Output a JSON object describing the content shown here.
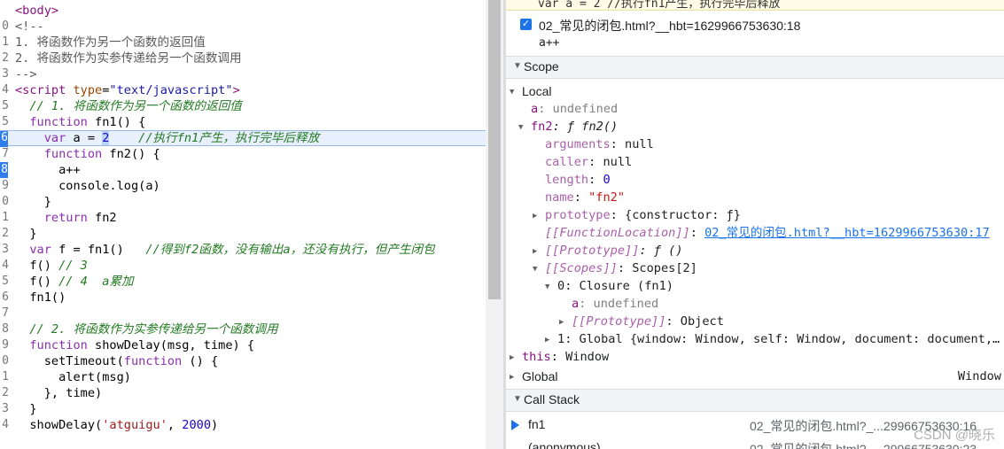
{
  "editor": {
    "lines": [
      {
        "gutter": "",
        "parts": [
          {
            "t": "<body>",
            "c": "tag"
          }
        ]
      },
      {
        "gutter": "0",
        "parts": [
          {
            "t": "<!--",
            "c": "cmb"
          }
        ]
      },
      {
        "gutter": "1",
        "parts": [
          {
            "t": "1. 将函数作为另一个函数的返回值",
            "c": "cmb"
          }
        ]
      },
      {
        "gutter": "2",
        "parts": [
          {
            "t": "2. 将函数作为实参传递给另一个函数调用",
            "c": "cmb"
          }
        ]
      },
      {
        "gutter": "3",
        "parts": [
          {
            "t": "-->",
            "c": "cmb"
          }
        ]
      },
      {
        "gutter": "4",
        "parts": [
          {
            "t": "<script ",
            "c": "tag"
          },
          {
            "t": "type",
            "c": "attr"
          },
          {
            "t": "=",
            "c": ""
          },
          {
            "t": "\"text/javascript\"",
            "c": "attrv"
          },
          {
            "t": ">",
            "c": "tag"
          }
        ]
      },
      {
        "gutter": "5",
        "parts": [
          {
            "t": "  // 1. 将函数作为另一个函数的返回值",
            "c": "cm"
          }
        ]
      },
      {
        "gutter": "5",
        "parts": [
          {
            "t": "  ",
            "c": ""
          },
          {
            "t": "function",
            "c": "kw"
          },
          {
            "t": " fn1() {",
            "c": ""
          }
        ]
      },
      {
        "gutter": "6",
        "bp": true,
        "hl": true,
        "parts": [
          {
            "t": "    ",
            "c": ""
          },
          {
            "t": "var",
            "c": "kw"
          },
          {
            "t": " a = ",
            "c": ""
          },
          {
            "t": "2",
            "c": "num sel"
          },
          {
            "t": "    ",
            "c": ""
          },
          {
            "t": "//执行fn1产生，执行完毕后释放",
            "c": "cm"
          }
        ]
      },
      {
        "gutter": "7",
        "parts": [
          {
            "t": "    ",
            "c": ""
          },
          {
            "t": "function",
            "c": "kw"
          },
          {
            "t": " fn2() {",
            "c": ""
          }
        ]
      },
      {
        "gutter": "8",
        "bp": true,
        "parts": [
          {
            "t": "      a++",
            "c": ""
          }
        ]
      },
      {
        "gutter": "9",
        "parts": [
          {
            "t": "      console.log(a)",
            "c": ""
          }
        ]
      },
      {
        "gutter": "0",
        "parts": [
          {
            "t": "    }",
            "c": ""
          }
        ]
      },
      {
        "gutter": "1",
        "parts": [
          {
            "t": "    ",
            "c": ""
          },
          {
            "t": "return",
            "c": "kw"
          },
          {
            "t": " fn2",
            "c": ""
          }
        ]
      },
      {
        "gutter": "2",
        "parts": [
          {
            "t": "  }",
            "c": ""
          }
        ]
      },
      {
        "gutter": "3",
        "parts": [
          {
            "t": "  ",
            "c": ""
          },
          {
            "t": "var",
            "c": "kw"
          },
          {
            "t": " f = fn1()   ",
            "c": ""
          },
          {
            "t": "//得到f2函数，没有输出a，还没有执行，但产生闭包",
            "c": "cm"
          }
        ]
      },
      {
        "gutter": "4",
        "parts": [
          {
            "t": "  f() ",
            "c": ""
          },
          {
            "t": "// 3",
            "c": "cm"
          }
        ]
      },
      {
        "gutter": "5",
        "parts": [
          {
            "t": "  f() ",
            "c": ""
          },
          {
            "t": "// 4  a累加",
            "c": "cm"
          }
        ]
      },
      {
        "gutter": "6",
        "parts": [
          {
            "t": "  fn1()",
            "c": ""
          }
        ]
      },
      {
        "gutter": "7",
        "parts": [
          {
            "t": "",
            "c": ""
          }
        ]
      },
      {
        "gutter": "8",
        "parts": [
          {
            "t": "  // 2. 将函数作为实参传递给另一个函数调用",
            "c": "cm"
          }
        ]
      },
      {
        "gutter": "9",
        "parts": [
          {
            "t": "  ",
            "c": ""
          },
          {
            "t": "function",
            "c": "kw"
          },
          {
            "t": " showDelay(msg, time) {",
            "c": ""
          }
        ]
      },
      {
        "gutter": "0",
        "parts": [
          {
            "t": "    setTimeout(",
            "c": ""
          },
          {
            "t": "function",
            "c": "kw"
          },
          {
            "t": " () {",
            "c": ""
          }
        ]
      },
      {
        "gutter": "1",
        "parts": [
          {
            "t": "      alert(msg)",
            "c": ""
          }
        ]
      },
      {
        "gutter": "2",
        "parts": [
          {
            "t": "    }, time)",
            "c": ""
          }
        ]
      },
      {
        "gutter": "3",
        "parts": [
          {
            "t": "  }",
            "c": ""
          }
        ]
      },
      {
        "gutter": "4",
        "parts": [
          {
            "t": "  showDelay(",
            "c": ""
          },
          {
            "t": "'atguigu'",
            "c": "str"
          },
          {
            "t": ", ",
            "c": ""
          },
          {
            "t": "2000",
            "c": "num"
          },
          {
            "t": ")",
            "c": ""
          }
        ]
      }
    ]
  },
  "paused_banner": "var a = 2 //执行fn1产生，执行完毕后释放",
  "breakpoint": {
    "name": "02_常见的闭包.html?__hbt=1629966753630:18",
    "code": "a++",
    "checked": true
  },
  "scope": {
    "title": "Scope",
    "rows": [
      {
        "i": 0,
        "exp": "▼",
        "k": "Local",
        "kc": "hdr"
      },
      {
        "i": 1,
        "exp": "",
        "k": "a",
        "kc": "pk",
        "v": ": undefined",
        "vc": "pv-null"
      },
      {
        "i": 1,
        "exp": "▼",
        "k": "fn2",
        "kc": "pk",
        "v": ": ƒ fn2()",
        "vc": "ital"
      },
      {
        "i": 2,
        "exp": "",
        "k": "arguments",
        "kc": "pkd",
        "v": ": null",
        "vc": ""
      },
      {
        "i": 2,
        "exp": "",
        "k": "caller",
        "kc": "pkd",
        "v": ": null",
        "vc": ""
      },
      {
        "i": 2,
        "exp": "",
        "k": "length",
        "kc": "pkd",
        "v": ": ",
        "vc": "",
        "v2": "0",
        "v2c": "pv-num"
      },
      {
        "i": 2,
        "exp": "",
        "k": "name",
        "kc": "pkd",
        "v": ": ",
        "vc": "",
        "v2": "\"fn2\"",
        "v2c": "pv-str"
      },
      {
        "i": 2,
        "exp": "▶",
        "k": "prototype",
        "kc": "pkd",
        "v": ": {constructor: ƒ}",
        "vc": ""
      },
      {
        "i": 2,
        "exp": "",
        "k": "[[FunctionLocation]]",
        "kc": "pkl",
        "v": ": ",
        "vc": "",
        "v2": "02_常见的闭包.html?__hbt=1629966753630:17",
        "v2c": "lnk"
      },
      {
        "i": 2,
        "exp": "▶",
        "k": "[[Prototype]]",
        "kc": "pkl",
        "v": ": ƒ ()",
        "vc": "ital"
      },
      {
        "i": 2,
        "exp": "▼",
        "k": "[[Scopes]]",
        "kc": "pkl",
        "v": ": Scopes[2]",
        "vc": ""
      },
      {
        "i": 3,
        "exp": "▼",
        "k": "0",
        "kc": "",
        "v": ": Closure (fn1)",
        "vc": ""
      },
      {
        "i": 4,
        "exp": "",
        "k": "a",
        "kc": "pk",
        "v": ": undefined",
        "vc": "pv-null"
      },
      {
        "i": 4,
        "exp": "▶",
        "k": "[[Prototype]]",
        "kc": "pkl",
        "v": ": Object",
        "vc": ""
      },
      {
        "i": 3,
        "exp": "▶",
        "k": "1",
        "kc": "",
        "v": ": Global {window: Window, self: Window, document: document,…",
        "vc": ""
      },
      {
        "i": 0,
        "exp": "▶",
        "k": "this",
        "kc": "pk",
        "v": ": Window",
        "vc": ""
      },
      {
        "i": -1,
        "exp": "▶",
        "k": "Global",
        "kc": "hdr",
        "right": "Window"
      }
    ]
  },
  "call_stack": {
    "title": "Call Stack",
    "frames": [
      {
        "fn": "fn1",
        "loc": "02_常见的闭包.html?_...29966753630:16",
        "current": true
      },
      {
        "fn": "(anonymous)",
        "loc": "02_常见的闭包.html?_...29966753630:23",
        "current": false
      }
    ]
  },
  "watermark": "CSDN @晓乐"
}
